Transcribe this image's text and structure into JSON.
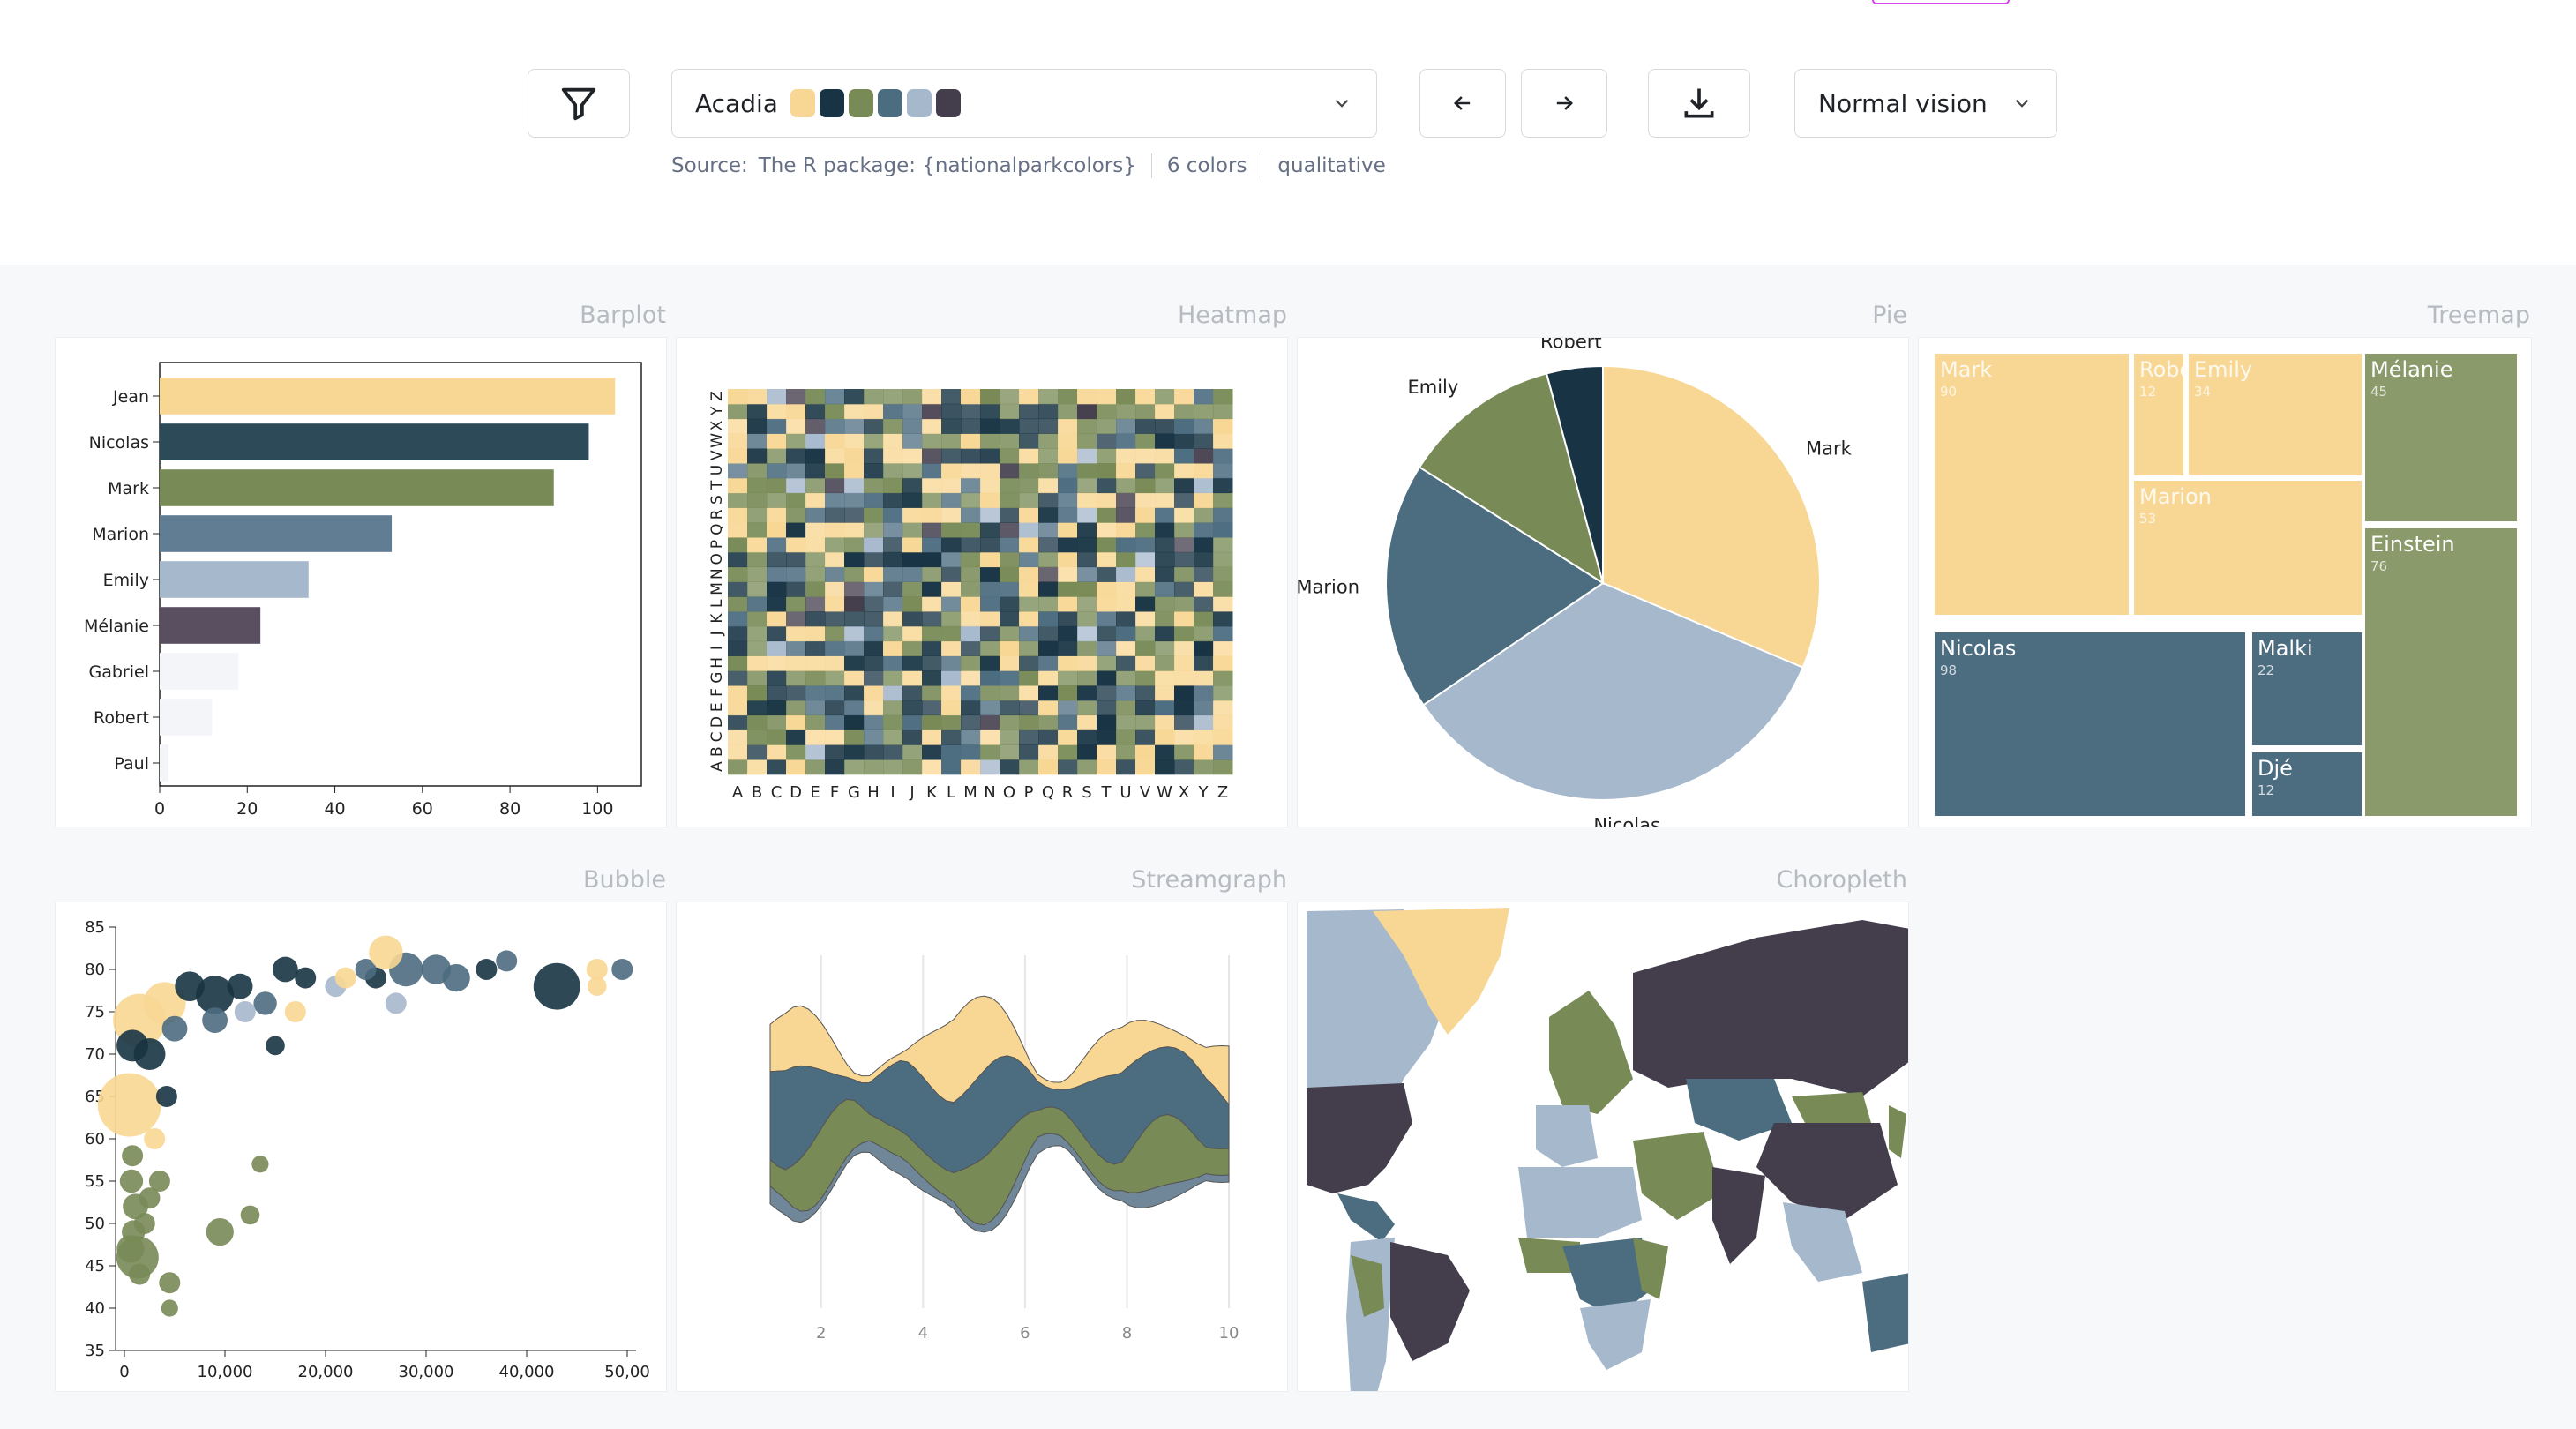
{
  "toolbar": {
    "palette_name": "Acadia",
    "palette_colors": [
      "#f8d794",
      "#183444",
      "#788a56",
      "#4c6c80",
      "#a6b8cc",
      "#433d4c"
    ],
    "source_label": "Source:",
    "source_value": "The R package: {nationalparkcolors}",
    "color_count": "6 colors",
    "palette_type": "qualitative",
    "vision_select": "Normal vision",
    "icons": {
      "filter": "filter-icon",
      "prev": "arrow-left-icon",
      "next": "arrow-right-icon",
      "download": "download-icon",
      "chevron": "chevron-down-icon"
    }
  },
  "sections": {
    "barplot": "Barplot",
    "heatmap": "Heatmap",
    "pie": "Pie",
    "treemap": "Treemap",
    "bubble": "Bubble",
    "streamgraph": "Streamgraph",
    "choropleth": "Choropleth"
  },
  "chart_data": [
    {
      "id": "barplot",
      "type": "bar",
      "categories": [
        "Jean",
        "Nicolas",
        "Mark",
        "Marion",
        "Emily",
        "Mélanie",
        "Gabriel",
        "Robert",
        "Paul"
      ],
      "values": [
        104,
        98,
        90,
        53,
        34,
        23,
        18,
        12,
        2
      ],
      "colors": [
        "#f8d794",
        "#2c4a57",
        "#788a56",
        "#607d93",
        "#a6b8cc",
        "#5a4f60",
        "#f3f5f8",
        "#f3f5f8",
        "#f3f5f8"
      ],
      "xlim": [
        0,
        110
      ],
      "xticks": [
        0,
        20,
        40,
        60,
        80,
        100
      ]
    },
    {
      "id": "heatmap",
      "type": "heatmap",
      "x": [
        "A",
        "B",
        "C",
        "D",
        "E",
        "F",
        "G",
        "H",
        "I",
        "J",
        "K",
        "L",
        "M",
        "N",
        "O",
        "P",
        "Q",
        "R",
        "S",
        "T",
        "U",
        "V",
        "W",
        "X",
        "Y",
        "Z"
      ],
      "y": [
        "A",
        "B",
        "C",
        "D",
        "E",
        "F",
        "G",
        "H",
        "I",
        "J",
        "K",
        "L",
        "M",
        "N",
        "O",
        "P",
        "Q",
        "R",
        "S",
        "T",
        "U",
        "V",
        "W",
        "X",
        "Y",
        "Z"
      ]
    },
    {
      "id": "pie",
      "type": "pie",
      "labels": [
        "Mark",
        "Nicolas",
        "Marion",
        "Emily",
        "Robert"
      ],
      "values": [
        90,
        98,
        53,
        34,
        12
      ],
      "colors": [
        "#f8d794",
        "#a6b8cc",
        "#4c6c80",
        "#788a56",
        "#183444"
      ]
    },
    {
      "id": "treemap",
      "type": "treemap",
      "items": [
        {
          "name": "Mark",
          "value": "90"
        },
        {
          "name": "Robert",
          "value": "12",
          "display": "Robe"
        },
        {
          "name": "Emily",
          "value": "34"
        },
        {
          "name": "Marion",
          "value": "53"
        },
        {
          "name": "Nicolas",
          "value": "98"
        },
        {
          "name": "Malki",
          "value": "22"
        },
        {
          "name": "Djé",
          "value": "12"
        },
        {
          "name": "Mélanie",
          "value": "45"
        },
        {
          "name": "Einstein",
          "value": "76"
        }
      ]
    },
    {
      "id": "bubble",
      "type": "scatter",
      "xlim": [
        0,
        50000
      ],
      "ylim": [
        35,
        85
      ],
      "xticks": [
        "0",
        "10,000",
        "20,000",
        "30,000",
        "40,000",
        "50,00"
      ],
      "yticks": [
        35,
        40,
        45,
        50,
        55,
        60,
        65,
        70,
        75,
        80,
        85
      ],
      "points": [
        {
          "x": 500,
          "y": 64,
          "r": 3,
          "c": 0
        },
        {
          "x": 1500,
          "y": 74,
          "r": 2.5,
          "c": 0
        },
        {
          "x": 4000,
          "y": 76,
          "r": 2,
          "c": 0
        },
        {
          "x": 800,
          "y": 71,
          "r": 1.5,
          "c": 1
        },
        {
          "x": 2500,
          "y": 70,
          "r": 1.5,
          "c": 1
        },
        {
          "x": 4200,
          "y": 65,
          "r": 1,
          "c": 1
        },
        {
          "x": 6500,
          "y": 78,
          "r": 1.4,
          "c": 1
        },
        {
          "x": 9000,
          "y": 77,
          "r": 1.8,
          "c": 1
        },
        {
          "x": 11500,
          "y": 78,
          "r": 1.2,
          "c": 1
        },
        {
          "x": 16000,
          "y": 80,
          "r": 1.2,
          "c": 1
        },
        {
          "x": 18000,
          "y": 79,
          "r": 1,
          "c": 1
        },
        {
          "x": 25000,
          "y": 79,
          "r": 1,
          "c": 1
        },
        {
          "x": 36000,
          "y": 80,
          "r": 1,
          "c": 1
        },
        {
          "x": 43000,
          "y": 78,
          "r": 2.2,
          "c": 1
        },
        {
          "x": 15000,
          "y": 71,
          "r": 0.9,
          "c": 1
        },
        {
          "x": 5000,
          "y": 73,
          "r": 1.2,
          "c": 3
        },
        {
          "x": 9000,
          "y": 74,
          "r": 1.2,
          "c": 3
        },
        {
          "x": 14000,
          "y": 76,
          "r": 1.1,
          "c": 3
        },
        {
          "x": 24000,
          "y": 80,
          "r": 1,
          "c": 3
        },
        {
          "x": 28000,
          "y": 80,
          "r": 1.6,
          "c": 3
        },
        {
          "x": 31000,
          "y": 80,
          "r": 1.4,
          "c": 3
        },
        {
          "x": 33000,
          "y": 79,
          "r": 1.3,
          "c": 3
        },
        {
          "x": 38000,
          "y": 81,
          "r": 1,
          "c": 3
        },
        {
          "x": 49500,
          "y": 80,
          "r": 1,
          "c": 3
        },
        {
          "x": 12000,
          "y": 75,
          "r": 1,
          "c": 4
        },
        {
          "x": 21000,
          "y": 78,
          "r": 1,
          "c": 4
        },
        {
          "x": 27000,
          "y": 76,
          "r": 1,
          "c": 4
        },
        {
          "x": 47000,
          "y": 80,
          "r": 1,
          "c": 0
        },
        {
          "x": 47000,
          "y": 78,
          "r": 0.9,
          "c": 0
        },
        {
          "x": 26000,
          "y": 82,
          "r": 1.6,
          "c": 0
        },
        {
          "x": 22000,
          "y": 79,
          "r": 1,
          "c": 0
        },
        {
          "x": 17000,
          "y": 75,
          "r": 1,
          "c": 0
        },
        {
          "x": 3000,
          "y": 60,
          "r": 1,
          "c": 0
        },
        {
          "x": 800,
          "y": 58,
          "r": 1,
          "c": 2
        },
        {
          "x": 700,
          "y": 55,
          "r": 1.1,
          "c": 2
        },
        {
          "x": 1100,
          "y": 52,
          "r": 1.2,
          "c": 2
        },
        {
          "x": 900,
          "y": 49,
          "r": 1.1,
          "c": 2
        },
        {
          "x": 1300,
          "y": 46,
          "r": 2,
          "c": 2
        },
        {
          "x": 600,
          "y": 47,
          "r": 1.3,
          "c": 2
        },
        {
          "x": 1500,
          "y": 44,
          "r": 1,
          "c": 2
        },
        {
          "x": 2000,
          "y": 50,
          "r": 1,
          "c": 2
        },
        {
          "x": 3500,
          "y": 55,
          "r": 1,
          "c": 2
        },
        {
          "x": 4500,
          "y": 43,
          "r": 1,
          "c": 2
        },
        {
          "x": 4500,
          "y": 40,
          "r": 0.8,
          "c": 2
        },
        {
          "x": 9500,
          "y": 49,
          "r": 1.3,
          "c": 2
        },
        {
          "x": 12500,
          "y": 51,
          "r": 0.9,
          "c": 2
        },
        {
          "x": 13500,
          "y": 57,
          "r": 0.8,
          "c": 2
        },
        {
          "x": 2500,
          "y": 53,
          "r": 1,
          "c": 2
        }
      ],
      "colors": [
        "#f8d794",
        "#183444",
        "#788a56",
        "#4c6c80",
        "#a6b8cc",
        "#433d4c"
      ]
    },
    {
      "id": "streamgraph",
      "type": "area",
      "xlim": [
        1,
        10
      ],
      "xticks": [
        2,
        4,
        6,
        8,
        10
      ]
    }
  ]
}
